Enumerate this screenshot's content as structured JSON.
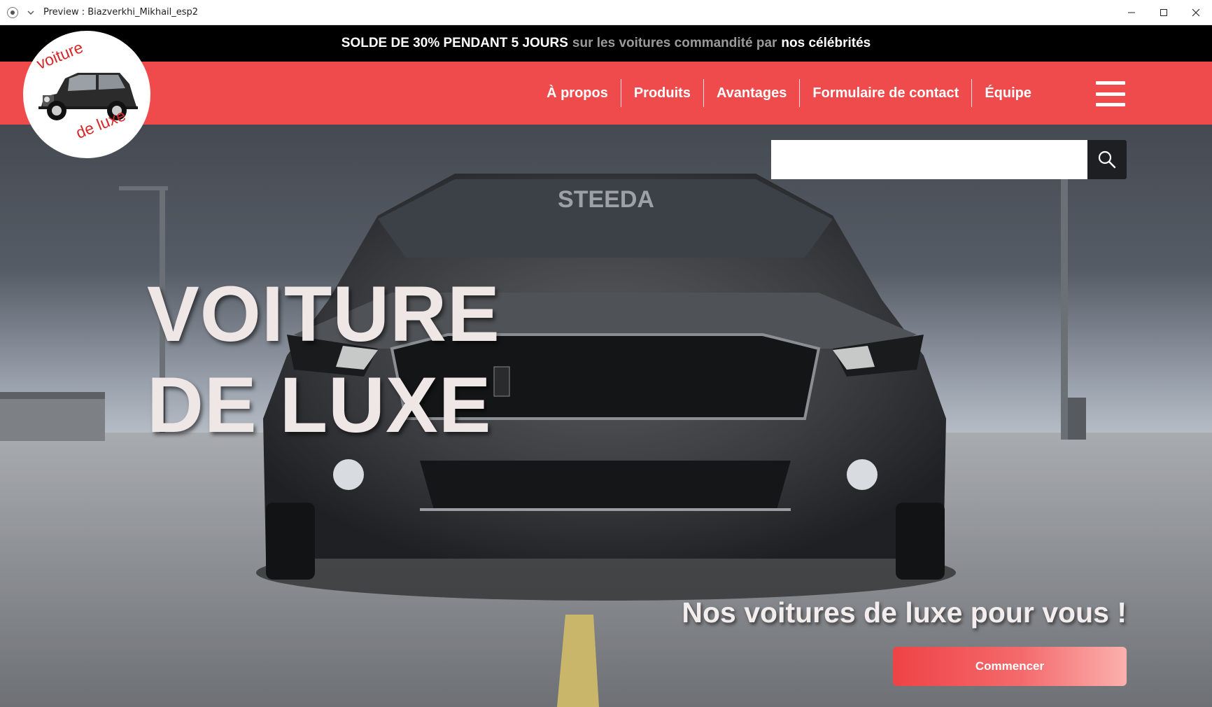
{
  "window": {
    "title": "Preview : Biazverkhi_Mikhail_esp2"
  },
  "promo": {
    "part1": "SOLDE DE 30% PENDANT 5 JOURS",
    "part2": "sur les voitures commandité par",
    "part3": "nos célébrités"
  },
  "logo": {
    "top": "voiture",
    "bottom": "de luxe"
  },
  "nav": {
    "items": [
      {
        "label": "À propos"
      },
      {
        "label": "Produits"
      },
      {
        "label": "Avantages"
      },
      {
        "label": "Formulaire de contact"
      },
      {
        "label": "Équipe"
      }
    ]
  },
  "search": {
    "value": "",
    "placeholder": ""
  },
  "hero": {
    "title_line1": "VOITURE",
    "title_line2": "DE LUXE",
    "tagline": "Nos voitures de luxe pour vous !",
    "cta_label": "Commencer",
    "windshield_text": "STEEDA"
  },
  "colors": {
    "brand_red": "#ef4b4c",
    "promo_bg": "#000000",
    "search_button": "#1d1f22"
  }
}
